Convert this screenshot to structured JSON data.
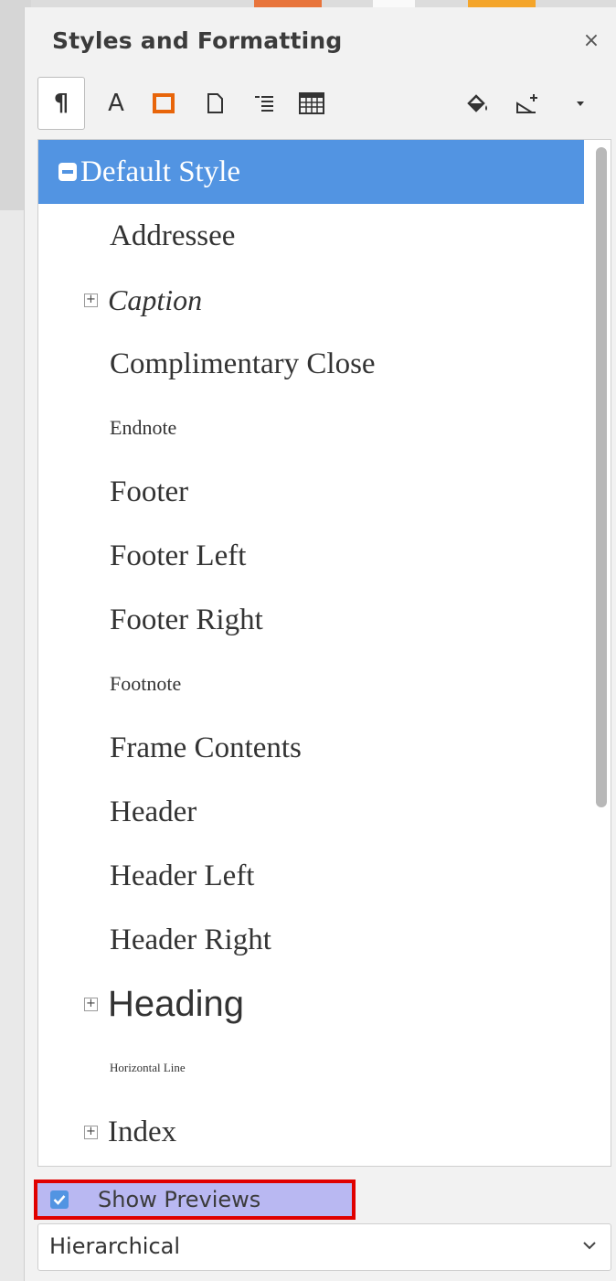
{
  "deck": {
    "title": "Styles and Formatting",
    "close_glyph": "×"
  },
  "toolbar": {
    "items": [
      {
        "name": "paragraph-styles-button",
        "icon": "pilcrow-icon",
        "glyph": "¶",
        "active": true
      },
      {
        "name": "character-styles-button",
        "icon": "letter-a-icon",
        "glyph": "A"
      },
      {
        "name": "frame-styles-button",
        "icon": "frame-icon"
      },
      {
        "name": "page-styles-button",
        "icon": "page-icon"
      },
      {
        "name": "list-styles-button",
        "icon": "list-icon"
      },
      {
        "name": "table-styles-button",
        "icon": "table-icon"
      },
      {
        "name": "fill-format-mode-button",
        "icon": "paint-bucket-icon"
      },
      {
        "name": "new-style-from-selection-button",
        "icon": "new-style-icon"
      },
      {
        "name": "style-actions-menu-button",
        "icon": "triangle-down-icon"
      }
    ],
    "frame_icon_color": "#e8650a"
  },
  "styles_list": {
    "selected_color": "#5294e2",
    "items": [
      {
        "label": "Default Style",
        "expander": "minus",
        "selected": true
      },
      {
        "label": "Addressee"
      },
      {
        "label": "Caption",
        "expander": "plus",
        "italic": true
      },
      {
        "label": "Complimentary Close"
      },
      {
        "label": "Endnote",
        "small": true
      },
      {
        "label": "Footer"
      },
      {
        "label": "Footer Left"
      },
      {
        "label": "Footer Right"
      },
      {
        "label": "Footnote",
        "small": true
      },
      {
        "label": "Frame Contents"
      },
      {
        "label": "Header"
      },
      {
        "label": "Header Left"
      },
      {
        "label": "Header Right"
      },
      {
        "label": "Heading",
        "expander": "plus",
        "heading": true
      },
      {
        "label": "Horizontal Line",
        "tiny": true
      },
      {
        "label": "Index",
        "expander": "plus"
      }
    ]
  },
  "show_previews": {
    "label": "Show Previews",
    "checked": true
  },
  "filter": {
    "value": "Hierarchical"
  }
}
